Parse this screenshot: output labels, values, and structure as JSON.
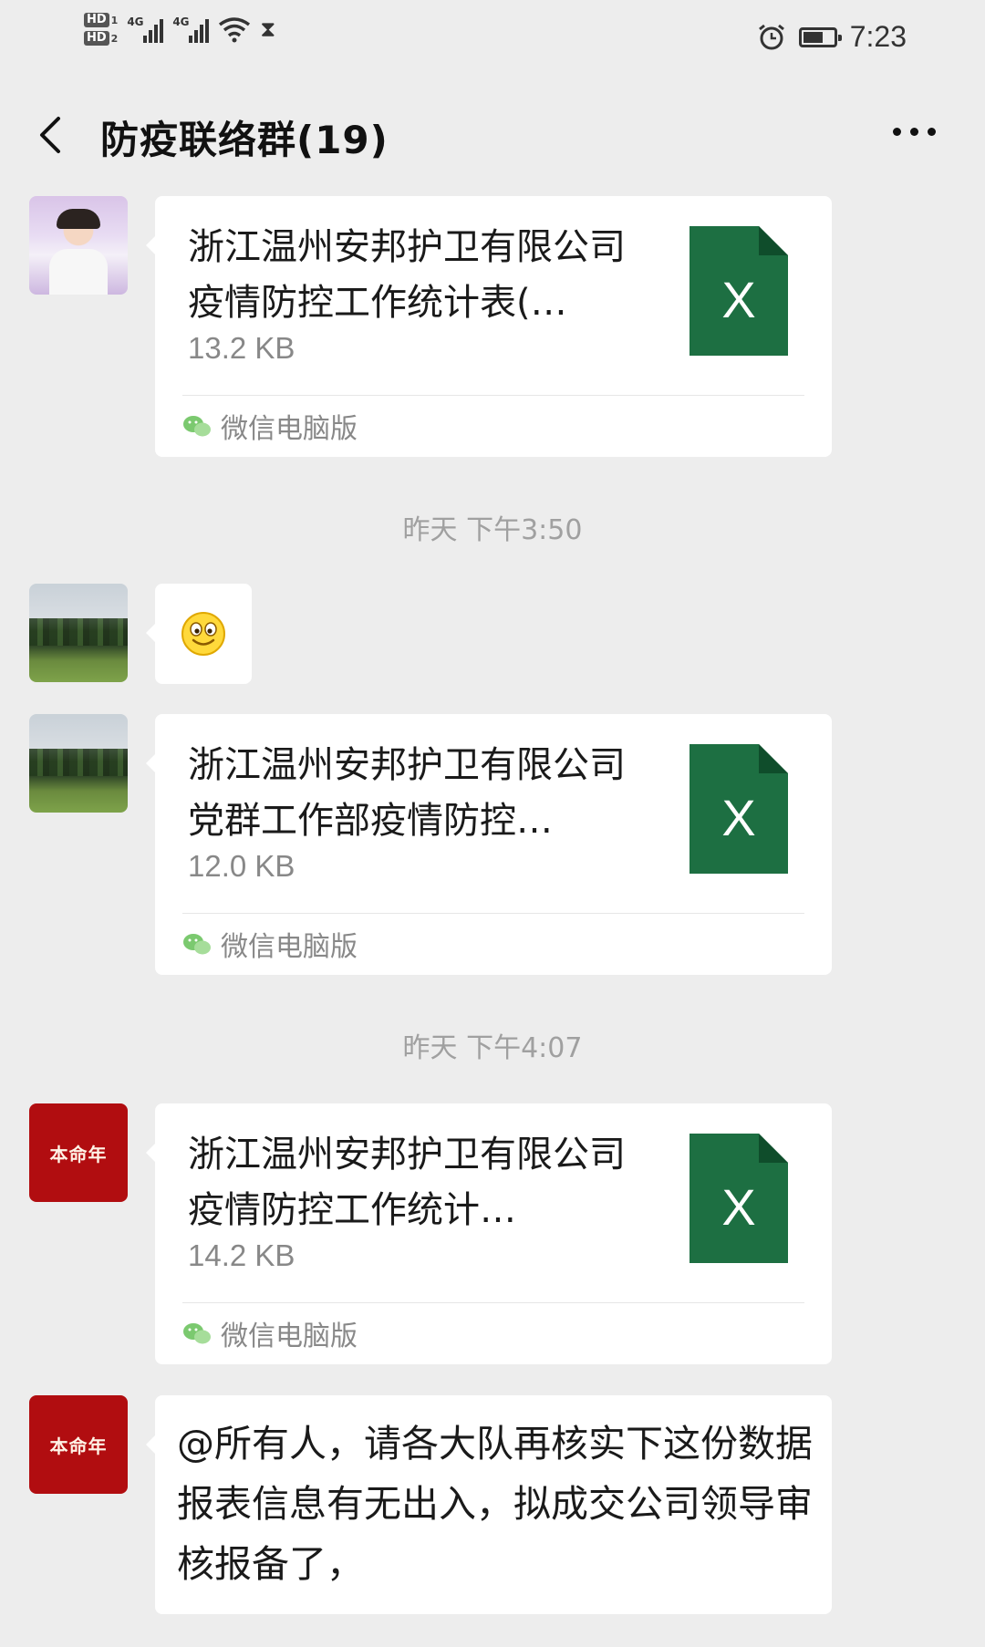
{
  "status_bar": {
    "hd1": "HD",
    "hd1_num": "1",
    "hd2": "HD",
    "hd2_num": "2",
    "net1": "4G",
    "net2": "4G",
    "time": "7:23",
    "battery_level": 0.6
  },
  "header": {
    "title": "防疫联络群(19)"
  },
  "messages": [
    {
      "type": "file",
      "avatar": "child-photo",
      "file_name": "浙江温州安邦护卫有限公司疫情防控工作统计表(…",
      "file_size": "13.2 KB",
      "source": "微信电脑版"
    },
    {
      "type": "timestamp",
      "text": "昨天 下午3:50"
    },
    {
      "type": "emoji",
      "avatar": "landscape-photo",
      "emoji": "smile-emoji"
    },
    {
      "type": "file",
      "avatar": "landscape-photo",
      "file_name": "浙江温州安邦护卫有限公司党群工作部疫情防控…",
      "file_size": "12.0 KB",
      "source": "微信电脑版"
    },
    {
      "type": "timestamp",
      "text": "昨天 下午4:07"
    },
    {
      "type": "file",
      "avatar_text": "本命年",
      "file_name": "浙江温州安邦护卫有限公司疫情防控工作统计…",
      "file_size": "14.2 KB",
      "source": "微信电脑版"
    },
    {
      "type": "text",
      "avatar_text": "本命年",
      "text": "@所有人，请各大队再核实下这份数据报表信息有无出入，拟成交公司领导审核报备了，"
    }
  ],
  "colors": {
    "background": "#ededed",
    "excel_green": "#1d6f42",
    "avatar_red": "#b10d10"
  }
}
